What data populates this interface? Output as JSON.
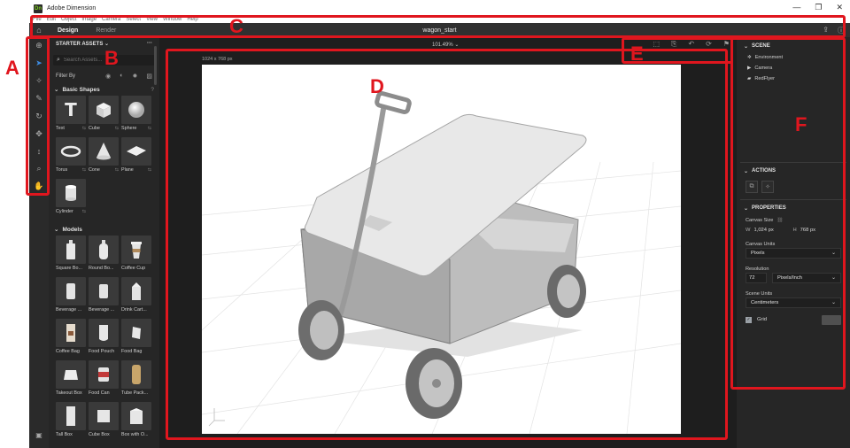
{
  "window": {
    "title": "Adobe Dimension",
    "logo_text": "Dn",
    "minimize": "—",
    "maximize": "❐",
    "close": "✕"
  },
  "menu": [
    "File",
    "Edit",
    "Object",
    "Image",
    "Camera",
    "Select",
    "View",
    "Window",
    "Help"
  ],
  "header": {
    "tabs": [
      "Design",
      "Render"
    ],
    "active_tab": "Design",
    "document_title": "wagon_start"
  },
  "assets": {
    "title": "STARTER ASSETS",
    "search_placeholder": "Search Assets...",
    "filter_label": "Filter By",
    "basic_shapes_title": "Basic Shapes",
    "basic_shapes": [
      {
        "label": "Text",
        "icon": "text-icon"
      },
      {
        "label": "Cube",
        "icon": "cube-icon"
      },
      {
        "label": "Sphere",
        "icon": "sphere-icon"
      },
      {
        "label": "Torus",
        "icon": "torus-icon"
      },
      {
        "label": "Cone",
        "icon": "cone-icon"
      },
      {
        "label": "Plane",
        "icon": "plane-icon"
      },
      {
        "label": "Cylinder",
        "icon": "cylinder-icon"
      }
    ],
    "models_title": "Models",
    "models": [
      {
        "label": "Square Bo..."
      },
      {
        "label": "Round Bo..."
      },
      {
        "label": "Coffee Cup"
      },
      {
        "label": "Beverage ..."
      },
      {
        "label": "Beverage ..."
      },
      {
        "label": "Drink Cart..."
      },
      {
        "label": "Coffee Bag"
      },
      {
        "label": "Food Pouch"
      },
      {
        "label": "Food Bag"
      },
      {
        "label": "Takeout Box"
      },
      {
        "label": "Food Can"
      },
      {
        "label": "Tube Pack..."
      },
      {
        "label": "Tall Box"
      },
      {
        "label": "Cube Box"
      },
      {
        "label": "Box with O..."
      }
    ]
  },
  "canvas": {
    "zoom": "101.49%",
    "size_label": "1024 x 768 px"
  },
  "scene": {
    "title": "SCENE",
    "items": [
      {
        "label": "Environment",
        "icon": "environment-icon"
      },
      {
        "label": "Camera",
        "icon": "camera-icon"
      },
      {
        "label": "RedFlyer",
        "icon": "folder-icon"
      }
    ]
  },
  "actions": {
    "title": "ACTIONS"
  },
  "properties": {
    "title": "PROPERTIES",
    "canvas_size_label": "Canvas Size",
    "width_key": "W",
    "width_value": "1,024 px",
    "height_key": "H",
    "height_value": "768 px",
    "canvas_units_label": "Canvas Units",
    "canvas_units_value": "Pixels",
    "resolution_label": "Resolution",
    "resolution_value": "72",
    "resolution_unit": "Pixels/Inch",
    "scene_units_label": "Scene Units",
    "scene_units_value": "Centimeters",
    "grid_label": "Grid",
    "grid_checked": true
  },
  "annotations": [
    "A",
    "B",
    "C",
    "D",
    "E",
    "F"
  ],
  "colors": {
    "annotation": "#e0161e",
    "accent": "#3d8be0",
    "panel": "#262626"
  }
}
